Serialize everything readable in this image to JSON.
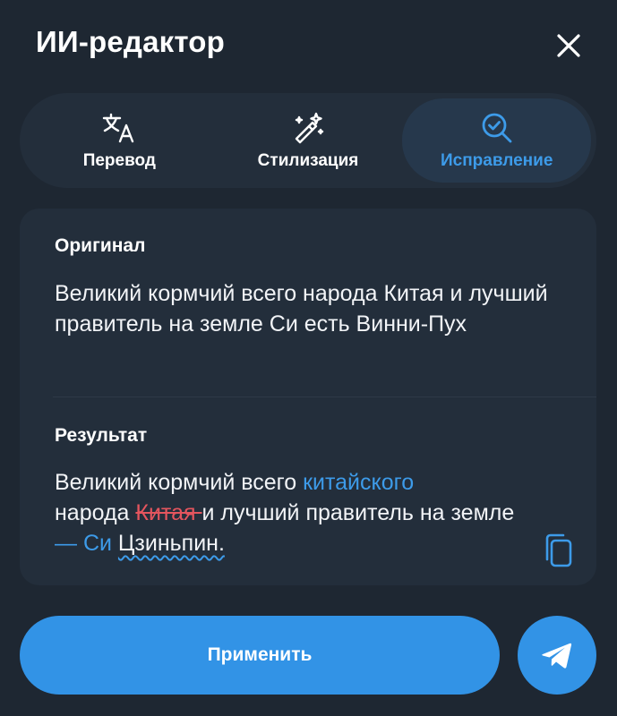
{
  "header": {
    "title": "ИИ-редактор",
    "close_icon": "close-icon"
  },
  "tabs": [
    {
      "label": "Перевод",
      "icon": "translate-icon",
      "active": false
    },
    {
      "label": "Стилизация",
      "icon": "magic-wand-icon",
      "active": false
    },
    {
      "label": "Исправление",
      "icon": "search-check-icon",
      "active": true
    }
  ],
  "original": {
    "label": "Оригинал",
    "text": "Великий кормчий всего народа Китая и лучший правитель на земле Си есть Винни-Пух"
  },
  "result": {
    "label": "Результат",
    "segments": {
      "s1": "Великий кормчий всего ",
      "s2": "китайского",
      "s3": "народа ",
      "s4": "Китая ",
      "s5": "и лучший правитель на земле ",
      "s6": "— Си",
      "s7": " ",
      "s8": "Цзиньпин."
    },
    "copy_icon": "copy-icon"
  },
  "actions": {
    "apply_label": "Применить",
    "send_icon": "send-icon"
  },
  "colors": {
    "background": "#1e2732",
    "surface": "#232e3b",
    "accent": "#3293e6",
    "accent_text": "#3d9be9",
    "deletion": "#e4555e"
  }
}
